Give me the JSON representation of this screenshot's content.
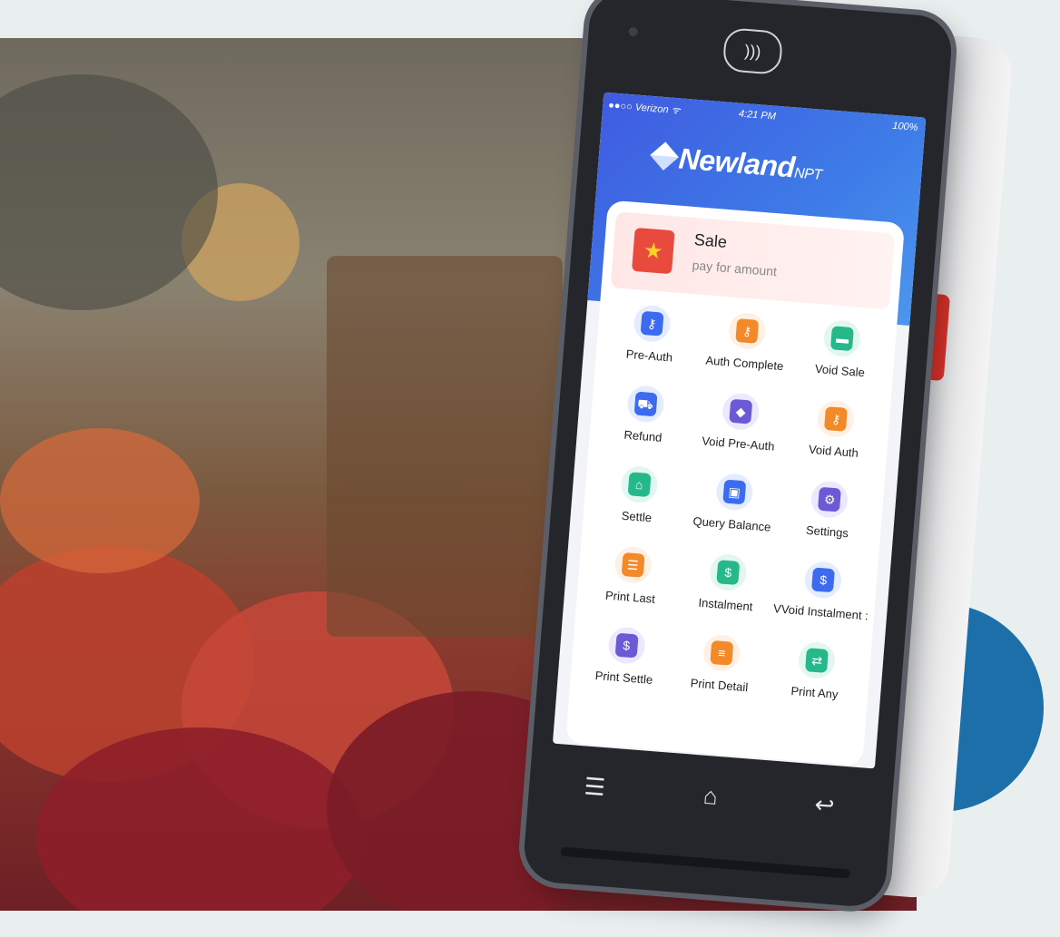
{
  "status_bar": {
    "carrier": "●●○○ Verizon ᯤ",
    "time": "4:21 PM",
    "battery": "100%"
  },
  "brand": {
    "name": "Newland",
    "suffix": "NPT"
  },
  "sale": {
    "title": "Sale",
    "subtitle": "pay for amount"
  },
  "menu": [
    {
      "label": "Pre-Auth",
      "icon": "key-card-icon",
      "glyph": "⚷",
      "bg": "#e4ecff",
      "fg": "#3d6bf0"
    },
    {
      "label": "Auth Complete",
      "icon": "key-card-icon",
      "glyph": "⚷",
      "bg": "#fff0e4",
      "fg": "#f28a2a"
    },
    {
      "label": "Void Sale",
      "icon": "card-void-icon",
      "glyph": "▬",
      "bg": "#e2f7f0",
      "fg": "#25b98a"
    },
    {
      "label": "Refund",
      "icon": "cart-icon",
      "glyph": "⛟",
      "bg": "#e4ecff",
      "fg": "#3d6bf0"
    },
    {
      "label": "Void Pre-Auth",
      "icon": "shield-icon",
      "glyph": "◆",
      "bg": "#ece8ff",
      "fg": "#6a5ad6"
    },
    {
      "label": "Void Auth",
      "icon": "key-card-icon",
      "glyph": "⚷",
      "bg": "#fff0e4",
      "fg": "#f28a2a"
    },
    {
      "label": "Settle",
      "icon": "basket-icon",
      "glyph": "⌂",
      "bg": "#e2f7f0",
      "fg": "#25b98a"
    },
    {
      "label": "Query Balance",
      "icon": "wallet-icon",
      "glyph": "▣",
      "bg": "#e4ecff",
      "fg": "#3d6bf0"
    },
    {
      "label": "Settings",
      "icon": "gear-icon",
      "glyph": "⚙",
      "bg": "#ece8ff",
      "fg": "#6a5ad6"
    },
    {
      "label": "Print Last",
      "icon": "receipt-icon",
      "glyph": "☰",
      "bg": "#fff0e4",
      "fg": "#f28a2a"
    },
    {
      "label": "Instalment",
      "icon": "document-icon",
      "glyph": "$",
      "bg": "#e2f7f0",
      "fg": "#25b98a"
    },
    {
      "label": "VVoid Instalment :",
      "icon": "document-icon",
      "glyph": "$",
      "bg": "#e4ecff",
      "fg": "#3d6bf0"
    },
    {
      "label": "Print Settle",
      "icon": "printer-icon",
      "glyph": "$",
      "bg": "#ece8ff",
      "fg": "#6a5ad6"
    },
    {
      "label": "Print Detail",
      "icon": "printer-icon",
      "glyph": "≡",
      "bg": "#fff0e4",
      "fg": "#f28a2a"
    },
    {
      "label": "Print Any",
      "icon": "shuffle-icon",
      "glyph": "⇄",
      "bg": "#e2f7f0",
      "fg": "#25b98a"
    }
  ],
  "nav": {
    "menu_icon": "☰",
    "home_icon": "⌂",
    "back_icon": "↩"
  }
}
